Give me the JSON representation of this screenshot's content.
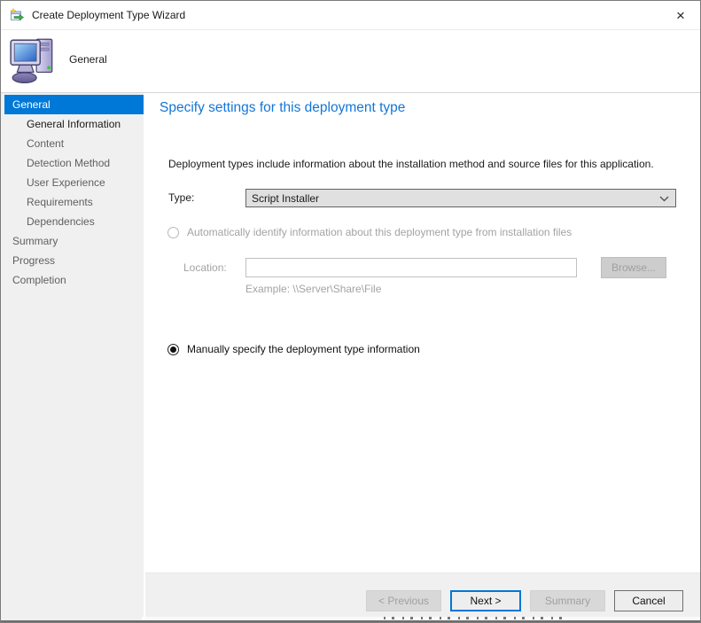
{
  "window": {
    "title": "Create Deployment Type Wizard",
    "close_glyph": "×"
  },
  "header": {
    "step_title": "General"
  },
  "sidebar": {
    "items": [
      {
        "label": "General",
        "state": "selected",
        "indent": 0
      },
      {
        "label": "General Information",
        "state": "current",
        "indent": 1
      },
      {
        "label": "Content",
        "state": "pending",
        "indent": 1
      },
      {
        "label": "Detection Method",
        "state": "pending",
        "indent": 1
      },
      {
        "label": "User Experience",
        "state": "pending",
        "indent": 1
      },
      {
        "label": "Requirements",
        "state": "pending",
        "indent": 1
      },
      {
        "label": "Dependencies",
        "state": "pending",
        "indent": 1
      },
      {
        "label": "Summary",
        "state": "pending",
        "indent": 0
      },
      {
        "label": "Progress",
        "state": "pending",
        "indent": 0
      },
      {
        "label": "Completion",
        "state": "pending",
        "indent": 0
      }
    ]
  },
  "main": {
    "heading": "Specify settings for this deployment type",
    "description": "Deployment types include information about the installation method and source files for this application.",
    "type_label": "Type:",
    "type_value": "Script Installer",
    "auto_radio_label": "Automatically identify information about this deployment type from installation files",
    "auto_radio_checked": false,
    "auto_radio_enabled": false,
    "location_label": "Location:",
    "location_value": "",
    "browse_label": "Browse...",
    "example_text": "Example: \\\\Server\\Share\\File",
    "manual_radio_label": "Manually specify the deployment type information",
    "manual_radio_checked": true
  },
  "footer": {
    "previous_label": "< Previous",
    "next_label": "Next >",
    "summary_label": "Summary",
    "cancel_label": "Cancel",
    "previous_enabled": false,
    "next_enabled": true,
    "summary_enabled": false,
    "cancel_enabled": true
  },
  "colors": {
    "accent": "#0078d7",
    "heading_blue": "#1376d6",
    "sidebar_bg": "#f0f0f0",
    "disabled_text": "#a3a3a3",
    "combobox_bg": "#e0e0e0"
  }
}
